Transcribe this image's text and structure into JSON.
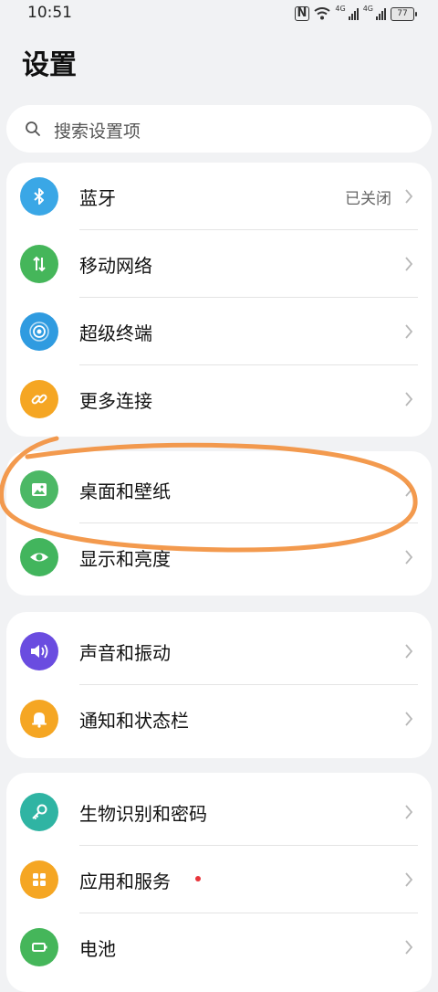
{
  "status_bar": {
    "time": "10:51",
    "signal_tag_1": "4G",
    "signal_tag_2": "4G",
    "battery": "77"
  },
  "page": {
    "title": "设置"
  },
  "search": {
    "placeholder": "搜索设置项"
  },
  "groups": [
    {
      "items": [
        {
          "label": "蓝牙",
          "value": "已关闭",
          "icon": "bluetooth-icon",
          "color": "#3aa7e6"
        },
        {
          "label": "移动网络",
          "icon": "mobile-data-icon",
          "color": "#45b65a"
        },
        {
          "label": "超级终端",
          "icon": "super-device-icon",
          "color": "#2f9be0"
        },
        {
          "label": "更多连接",
          "icon": "link-icon",
          "color": "#f5a623"
        }
      ]
    },
    {
      "items": [
        {
          "label": "桌面和壁纸",
          "icon": "wallpaper-icon",
          "color": "#4cb865"
        },
        {
          "label": "显示和亮度",
          "icon": "eye-icon",
          "color": "#42b55d"
        }
      ]
    },
    {
      "items": [
        {
          "label": "声音和振动",
          "icon": "sound-icon",
          "color": "#6a4ce0"
        },
        {
          "label": "通知和状态栏",
          "icon": "bell-icon",
          "color": "#f5a623"
        }
      ]
    },
    {
      "items": [
        {
          "label": "生物识别和密码",
          "icon": "key-icon",
          "color": "#2fb4a3"
        },
        {
          "label": "应用和服务",
          "icon": "apps-icon",
          "color": "#f5a623",
          "badge": "red-dot"
        },
        {
          "label": "电池",
          "icon": "battery-icon",
          "color": "#45b65a"
        }
      ]
    }
  ],
  "annotation": {
    "color": "#f2913f"
  }
}
